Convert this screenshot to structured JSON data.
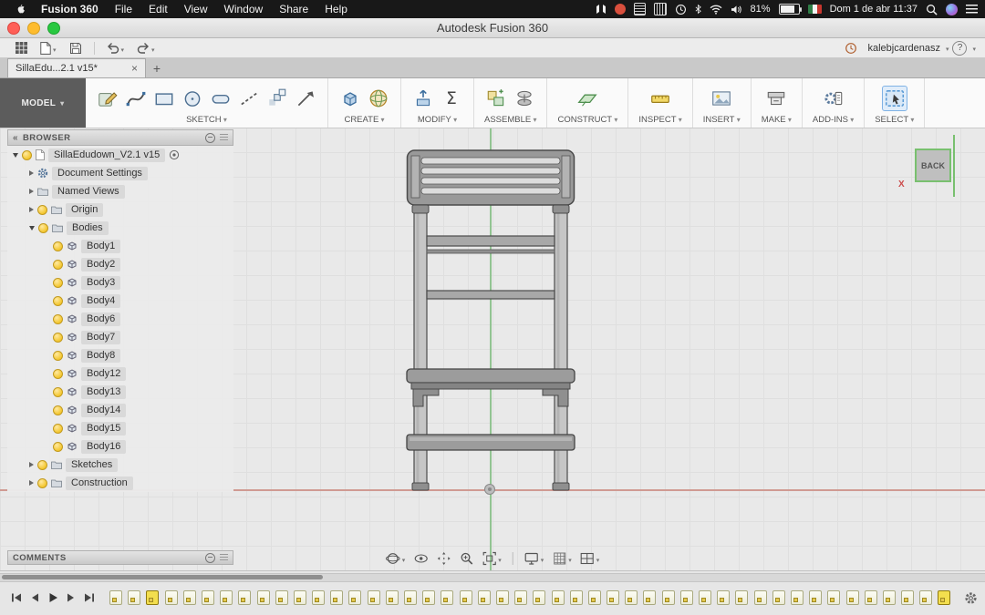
{
  "menubar": {
    "app_name": "Fusion 360",
    "menus": [
      "File",
      "Edit",
      "View",
      "Window",
      "Share",
      "Help"
    ],
    "battery": "81%",
    "datetime": "Dom 1 de abr 11:37"
  },
  "window": {
    "title": "Autodesk Fusion 360"
  },
  "quick_toolbar": {
    "user": "kalebjcardenasz",
    "help_label": "?"
  },
  "tabs": {
    "active_label": "SillaEdu...2.1 v15*"
  },
  "ribbon": {
    "model_label": "MODEL",
    "groups": [
      {
        "label": "SKETCH",
        "icons": [
          "create-sketch-icon",
          "spline-icon",
          "rectangle-icon",
          "circle-icon",
          "slot-icon",
          "construction-line-icon",
          "pattern-icon",
          "project-icon"
        ]
      },
      {
        "label": "CREATE",
        "icons": [
          "extrude-icon",
          "form-icon"
        ]
      },
      {
        "label": "MODIFY",
        "icons": [
          "press-pull-icon",
          "parameters-icon"
        ]
      },
      {
        "label": "ASSEMBLE",
        "icons": [
          "new-component-icon",
          "joint-icon"
        ]
      },
      {
        "label": "CONSTRUCT",
        "icons": [
          "plane-icon"
        ]
      },
      {
        "label": "INSPECT",
        "icons": [
          "measure-icon"
        ]
      },
      {
        "label": "INSERT",
        "icons": [
          "insert-image-icon"
        ]
      },
      {
        "label": "MAKE",
        "icons": [
          "print-icon"
        ]
      },
      {
        "label": "ADD-INS",
        "icons": [
          "scripts-addins-icon"
        ]
      },
      {
        "label": "SELECT",
        "icons": [
          "select-icon"
        ]
      }
    ]
  },
  "browser": {
    "header": "BROWSER",
    "root": {
      "label": "SillaEdudown_V2.1 v15",
      "expanded": true
    },
    "items": [
      {
        "label": "Document Settings",
        "icon": "gear-icon",
        "bulb": false
      },
      {
        "label": "Named Views",
        "icon": "folder-icon",
        "bulb": false
      },
      {
        "label": "Origin",
        "icon": "folder-icon",
        "bulb": true
      },
      {
        "label": "Bodies",
        "icon": "folder-icon",
        "bulb": true,
        "expanded": true,
        "children": [
          "Body1",
          "Body2",
          "Body3",
          "Body4",
          "Body6",
          "Body7",
          "Body8",
          "Body12",
          "Body13",
          "Body14",
          "Body15",
          "Body16"
        ]
      },
      {
        "label": "Sketches",
        "icon": "folder-icon",
        "bulb": true
      },
      {
        "label": "Construction",
        "icon": "folder-icon",
        "bulb": true
      }
    ]
  },
  "viewcube": {
    "face_label": "BACK",
    "axis_x_label": "X"
  },
  "comments": {
    "header": "COMMENTS"
  },
  "nav_toolbar": {
    "buttons": [
      {
        "icon": "orbit-icon",
        "caret": true
      },
      {
        "icon": "look-at-icon"
      },
      {
        "icon": "pan-icon"
      },
      {
        "icon": "zoom-icon"
      },
      {
        "icon": "fit-icon",
        "caret": true
      },
      {
        "icon": "separator"
      },
      {
        "icon": "display-settings-icon",
        "caret": true
      },
      {
        "icon": "grid-display-icon",
        "caret": true
      },
      {
        "icon": "viewports-icon",
        "caret": true
      }
    ]
  },
  "timeline": {
    "playback": [
      "skip-to-start-icon",
      "step-back-icon",
      "play-icon",
      "step-forward-icon",
      "skip-to-end-icon"
    ],
    "feature_count": 46,
    "highlighted_indices": [
      2,
      45
    ]
  }
}
